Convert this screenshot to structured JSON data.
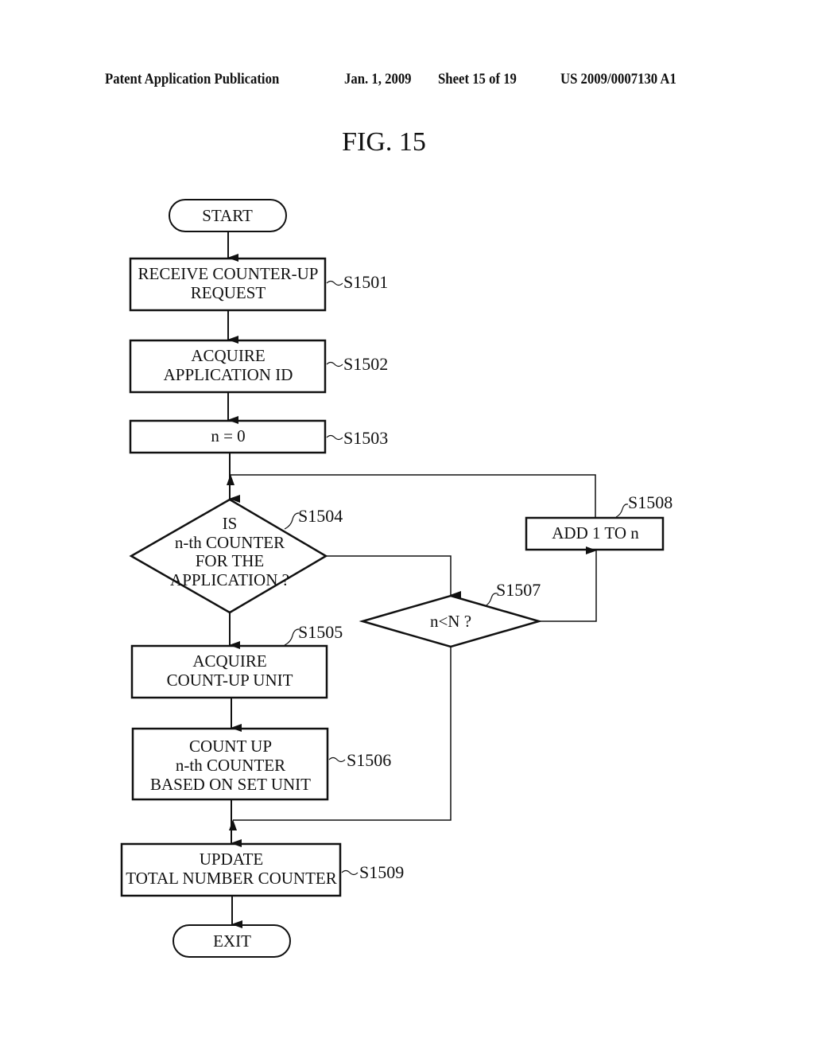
{
  "header": {
    "publication": "Patent Application Publication",
    "date": "Jan. 1, 2009",
    "sheet": "Sheet 15 of 19",
    "number": "US 2009/0007130 A1"
  },
  "figure": {
    "title": "FIG. 15"
  },
  "flowchart": {
    "start": "START",
    "exit": "EXIT",
    "steps": [
      {
        "id": "S1501",
        "type": "process",
        "lines": [
          "RECEIVE COUNTER-UP",
          "REQUEST"
        ]
      },
      {
        "id": "S1502",
        "type": "process",
        "lines": [
          "ACQUIRE",
          "APPLICATION ID"
        ]
      },
      {
        "id": "S1503",
        "type": "process",
        "lines": [
          "n = 0"
        ]
      },
      {
        "id": "S1504",
        "type": "decision",
        "lines": [
          "IS",
          "n-th COUNTER",
          "FOR THE",
          "APPLICATION ?"
        ]
      },
      {
        "id": "S1505",
        "type": "process",
        "lines": [
          "ACQUIRE",
          "COUNT-UP UNIT"
        ]
      },
      {
        "id": "S1506",
        "type": "process",
        "lines": [
          "COUNT UP",
          "n-th COUNTER",
          "BASED ON SET UNIT"
        ]
      },
      {
        "id": "S1507",
        "type": "decision",
        "lines": [
          "n<N ?"
        ]
      },
      {
        "id": "S1508",
        "type": "process",
        "lines": [
          "ADD 1 TO n"
        ]
      },
      {
        "id": "S1509",
        "type": "process",
        "lines": [
          "UPDATE",
          "TOTAL NUMBER COUNTER"
        ]
      }
    ]
  }
}
